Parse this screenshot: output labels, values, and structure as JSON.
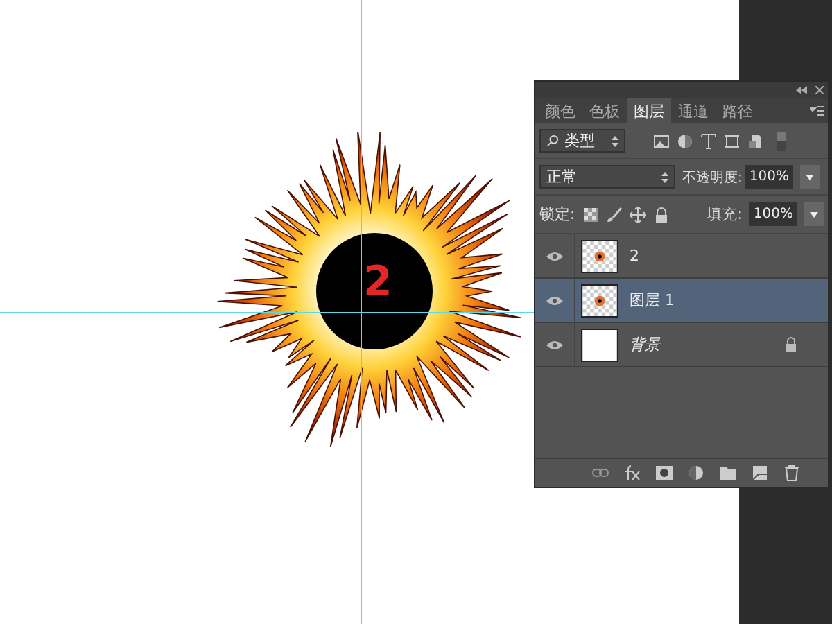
{
  "canvas": {
    "label": "2"
  },
  "panel": {
    "tabs": [
      {
        "label": "颜色",
        "selected": false
      },
      {
        "label": "色板",
        "selected": false
      },
      {
        "label": "图层",
        "selected": true
      },
      {
        "label": "通道",
        "selected": false
      },
      {
        "label": "路径",
        "selected": false
      }
    ],
    "filter": {
      "value": "类型"
    },
    "blend_mode": {
      "value": "正常"
    },
    "opacity": {
      "label": "不透明度:",
      "value": "100%"
    },
    "lock": {
      "label": "锁定:"
    },
    "fill": {
      "label": "填充:",
      "value": "100%"
    },
    "layers": [
      {
        "name": "2",
        "kind": "image",
        "visible": true,
        "selected": false,
        "locked": false
      },
      {
        "name": "图层 1",
        "kind": "image",
        "visible": true,
        "selected": true,
        "locked": false
      },
      {
        "name": "背景",
        "kind": "background",
        "visible": true,
        "selected": false,
        "locked": true
      }
    ]
  }
}
